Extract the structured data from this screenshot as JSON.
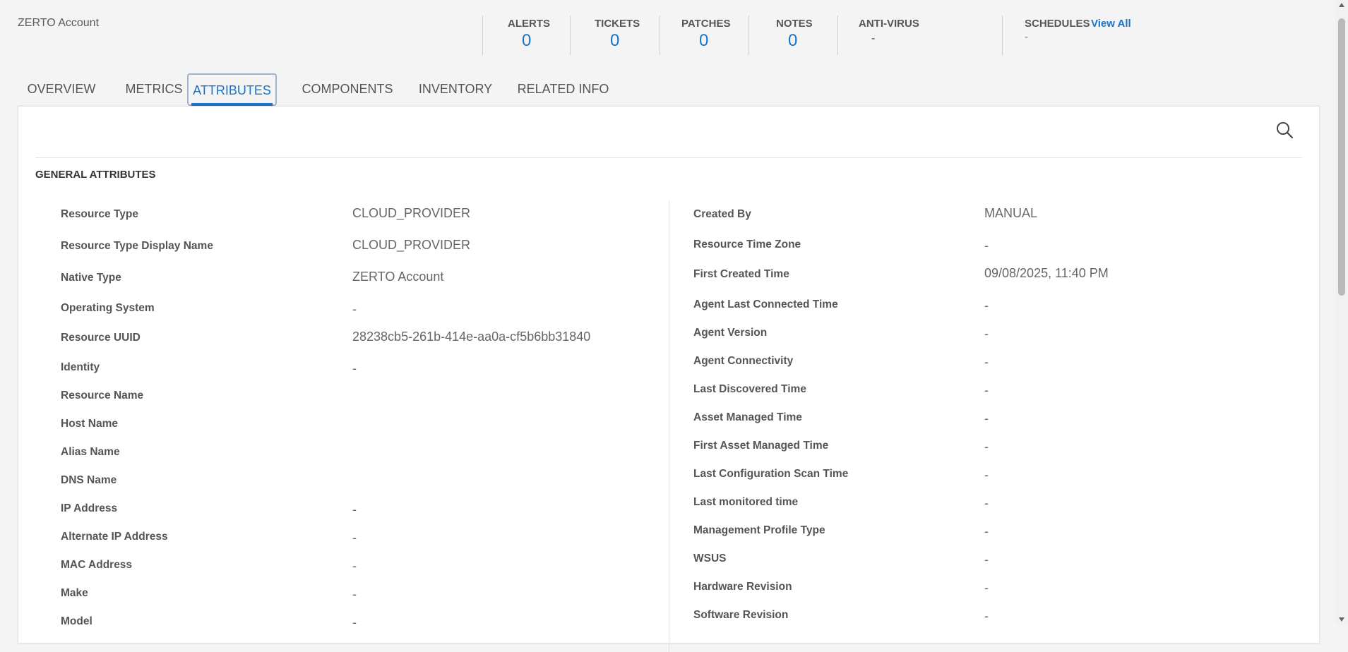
{
  "resource": {
    "name": "ZERTO Account"
  },
  "summary": {
    "alerts": {
      "label": "ALERTS",
      "value": "0"
    },
    "tickets": {
      "label": "TICKETS",
      "value": "0"
    },
    "patches": {
      "label": "PATCHES",
      "value": "0"
    },
    "notes": {
      "label": "NOTES",
      "value": "0"
    },
    "antivirus": {
      "label": "ANTI-VIRUS",
      "value": "-"
    },
    "schedules": {
      "label": "SCHEDULES",
      "link": "View All",
      "value": "-"
    }
  },
  "tabs": [
    {
      "label": "OVERVIEW"
    },
    {
      "label": "METRICS"
    },
    {
      "label": "ATTRIBUTES"
    },
    {
      "label": "COMPONENTS"
    },
    {
      "label": "INVENTORY"
    },
    {
      "label": "RELATED INFO"
    }
  ],
  "section_title": "GENERAL ATTRIBUTES",
  "left_attributes": [
    {
      "key": "Resource Type",
      "value": "CLOUD_PROVIDER"
    },
    {
      "key": "Resource Type Display Name",
      "value": "CLOUD_PROVIDER"
    },
    {
      "key": "Native Type",
      "value": "ZERTO Account"
    },
    {
      "key": "Operating System",
      "value": "-"
    },
    {
      "key": "Resource UUID",
      "value": "28238cb5-261b-414e-aa0a-cf5b6bb31840"
    },
    {
      "key": "Identity",
      "value": "-"
    },
    {
      "key": "Resource Name",
      "value": ""
    },
    {
      "key": "Host Name",
      "value": ""
    },
    {
      "key": "Alias Name",
      "value": ""
    },
    {
      "key": "DNS Name",
      "value": ""
    },
    {
      "key": "IP Address",
      "value": "-"
    },
    {
      "key": "Alternate IP Address",
      "value": "-"
    },
    {
      "key": "MAC Address",
      "value": "-"
    },
    {
      "key": "Make",
      "value": "-"
    },
    {
      "key": "Model",
      "value": "-"
    }
  ],
  "right_attributes": [
    {
      "key": "Created By",
      "value": "MANUAL"
    },
    {
      "key": "Resource Time Zone",
      "value": "-"
    },
    {
      "key": "First Created Time",
      "value": "09/08/2025, 11:40 PM"
    },
    {
      "key": "Agent Last Connected Time",
      "value": "-"
    },
    {
      "key": "Agent Version",
      "value": "-"
    },
    {
      "key": "Agent Connectivity",
      "value": "-"
    },
    {
      "key": "Last Discovered Time",
      "value": "-"
    },
    {
      "key": "Asset Managed Time",
      "value": "-"
    },
    {
      "key": "First Asset Managed Time",
      "value": "-"
    },
    {
      "key": "Last Configuration Scan Time",
      "value": "-"
    },
    {
      "key": "Last monitored time",
      "value": "-"
    },
    {
      "key": "Management Profile Type",
      "value": "-"
    },
    {
      "key": "WSUS",
      "value": "-"
    },
    {
      "key": "Hardware Revision",
      "value": "-"
    },
    {
      "key": "Software Revision",
      "value": "-"
    }
  ],
  "colors": {
    "accent": "#1a73c8",
    "active_tab_border": "#9fb3cc"
  }
}
